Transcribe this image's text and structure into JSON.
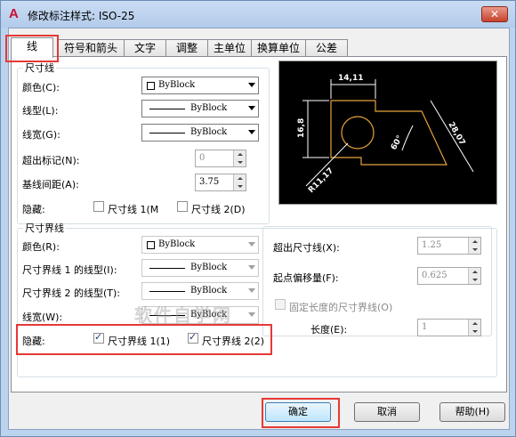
{
  "window": {
    "title": "修改标注样式: ISO-25",
    "close_label": "✕",
    "app_icon_glyph": "A"
  },
  "tabs": [
    {
      "label": "线",
      "active": true
    },
    {
      "label": "符号和箭头"
    },
    {
      "label": "文字"
    },
    {
      "label": "调整"
    },
    {
      "label": "主单位"
    },
    {
      "label": "换算单位"
    },
    {
      "label": "公差"
    }
  ],
  "dim_lines": {
    "group_title": "尺寸线",
    "color_label": "颜色(C):",
    "color_value": "ByBlock",
    "linetype_label": "线型(L):",
    "linetype_value": "ByBlock",
    "lineweight_label": "线宽(G):",
    "lineweight_value": "ByBlock",
    "extend_ticks_label": "超出标记(N):",
    "extend_ticks_value": "0",
    "baseline_spacing_label": "基线间距(A):",
    "baseline_spacing_value": "3.75",
    "suppress_label": "隐藏:",
    "suppress_1_label": "尺寸线 1(M",
    "suppress_1_checked": false,
    "suppress_2_label": "尺寸线 2(D)",
    "suppress_2_checked": false
  },
  "ext_lines": {
    "group_title": "尺寸界线",
    "color_label": "颜色(R):",
    "color_value": "ByBlock",
    "linetype1_label": "尺寸界线 1 的线型(I):",
    "linetype1_value": "ByBlock",
    "linetype2_label": "尺寸界线 2 的线型(T):",
    "linetype2_value": "ByBlock",
    "lineweight_label": "线宽(W):",
    "lineweight_value": "ByBlock",
    "suppress_label": "隐藏:",
    "suppress_1_label": "尺寸界线 1(1)",
    "suppress_1_checked": true,
    "suppress_2_label": "尺寸界线 2(2)",
    "suppress_2_checked": true,
    "extend_beyond_label": "超出尺寸线(X):",
    "extend_beyond_value": "1.25",
    "offset_label": "起点偏移量(F):",
    "offset_value": "0.625",
    "fixed_length_label": "固定长度的尺寸界线(O)",
    "fixed_length_checked": false,
    "length_label": "长度(E):",
    "length_value": "1"
  },
  "preview": {
    "dim_top": "14,11",
    "dim_left": "16,8",
    "dim_right": "28,07",
    "dim_angle": "60°",
    "dim_radius": "R11,17",
    "colors": {
      "background": "#000000",
      "geometry": "#e6a23c",
      "dims": "#ffffff"
    }
  },
  "buttons": {
    "ok": "确定",
    "cancel": "取消",
    "help": "帮助(H)"
  },
  "watermark": "软件自学网",
  "colors": {
    "highlight": "#e53935",
    "title_bar": "#bcd3ee"
  }
}
